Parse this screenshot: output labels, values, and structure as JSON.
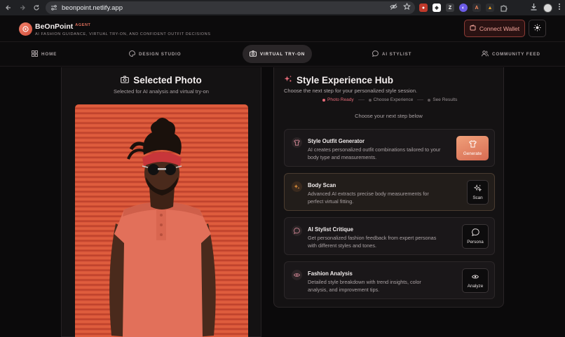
{
  "browser": {
    "url": "beonpoint.netlify.app"
  },
  "header": {
    "brand": "BeOnPoint",
    "brand_tag": "AGENT",
    "tagline": "AI FASHION GUIDANCE, VIRTUAL TRY-ON, AND CONFIDENT OUTFIT DECISIONS",
    "connect_label": "Connect Wallet"
  },
  "nav": {
    "items": [
      {
        "label": "HOME",
        "icon": "grid-icon"
      },
      {
        "label": "DESIGN STUDIO",
        "icon": "palette-icon"
      },
      {
        "label": "VIRTUAL TRY-ON",
        "icon": "camera-icon",
        "active": true
      },
      {
        "label": "AI STYLIST",
        "icon": "chat-icon"
      },
      {
        "label": "COMMUNITY FEED",
        "icon": "users-icon"
      }
    ]
  },
  "left": {
    "title": "Selected Photo",
    "subtitle": "Selected for AI analysis and virtual try-on"
  },
  "right": {
    "title": "Style Experience Hub",
    "subtitle": "Choose the next step for your personalized style session.",
    "steps": [
      "Photo Ready",
      "Choose Experience",
      "See Results"
    ],
    "choose": "Choose your next step below",
    "cards": [
      {
        "title": "Style Outfit Generator",
        "desc": "AI creates personalized outfit combinations tailored to your body type and measurements.",
        "button": "Generate"
      },
      {
        "title": "Body Scan",
        "desc": "Advanced AI extracts precise body measurements for perfect virtual fitting.",
        "button": "Scan"
      },
      {
        "title": "AI Stylist Critique",
        "desc": "Get personalized fashion feedback from expert personas with different styles and tones.",
        "button": "Persona"
      },
      {
        "title": "Fashion Analysis",
        "desc": "Detailed style breakdown with trend insights, color analysis, and improvement tips.",
        "button": "Analyze"
      }
    ]
  },
  "colors": {
    "accent": "#e0705c",
    "active_step": "#e56a78",
    "background": "#0b0a0b"
  }
}
